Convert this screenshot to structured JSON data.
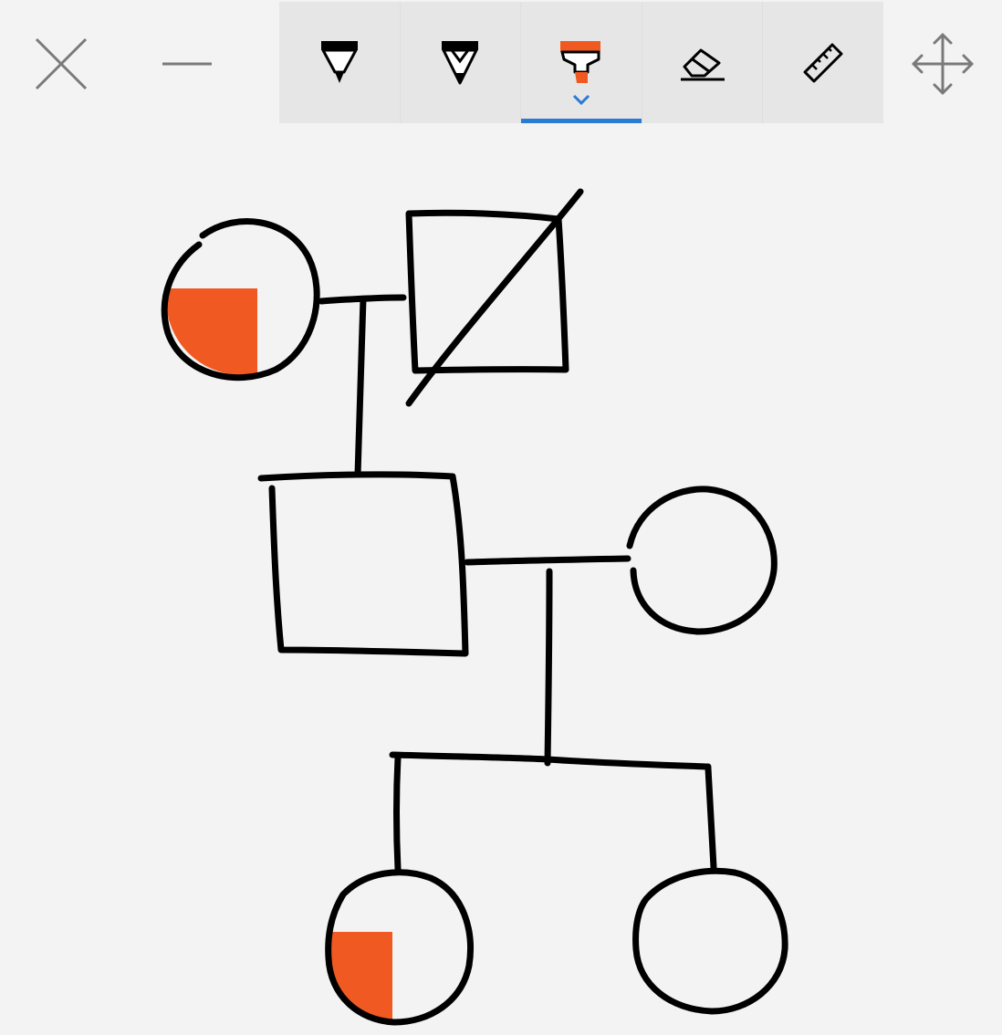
{
  "window": {
    "close_icon": "close-icon",
    "minimize_icon": "minimize-icon",
    "move_icon": "move-arrows-icon"
  },
  "toolbar": {
    "tools": [
      {
        "name": "ballpoint-pen",
        "icon": "ballpoint-pen-icon",
        "selected": false
      },
      {
        "name": "pencil",
        "icon": "pencil-icon",
        "selected": false
      },
      {
        "name": "highlighter",
        "icon": "highlighter-icon",
        "selected": true
      },
      {
        "name": "eraser",
        "icon": "eraser-icon",
        "selected": false
      },
      {
        "name": "ruler",
        "icon": "ruler-icon",
        "selected": false
      }
    ]
  },
  "colors": {
    "background": "#f3f3f3",
    "toolbar": "#e6e6e6",
    "ink": "#000000",
    "highlight": "#f05a22",
    "accent": "#2b7bd3",
    "icon_gray": "#7a7a7a"
  },
  "drawing": {
    "generations": [
      {
        "members": [
          {
            "sex": "female",
            "affected": true
          },
          {
            "sex": "male",
            "affected": false,
            "deceased": true
          }
        ]
      },
      {
        "members": [
          {
            "sex": "male",
            "affected": false
          },
          {
            "sex": "female",
            "affected": false
          }
        ]
      },
      {
        "members": [
          {
            "sex": "female",
            "affected": true
          },
          {
            "sex": "female",
            "affected": false
          }
        ]
      }
    ]
  }
}
